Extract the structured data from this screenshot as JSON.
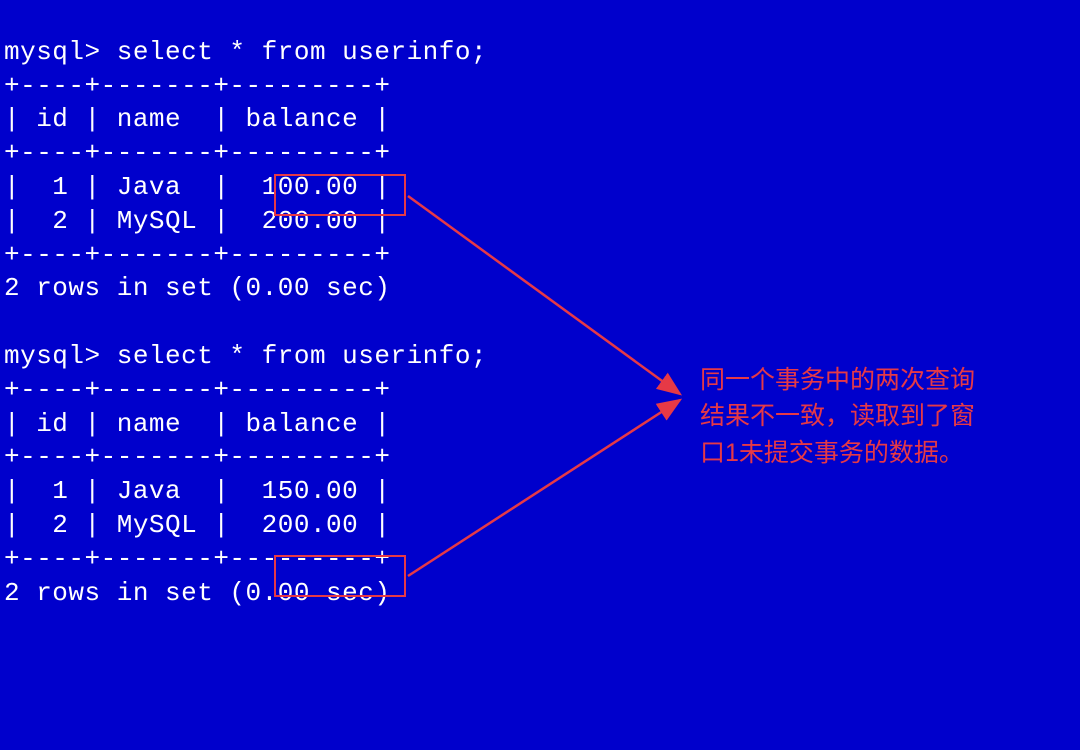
{
  "q1": {
    "prompt_cmd": "mysql> select * from userinfo;",
    "sep": "+----+-------+---------+",
    "hdr": "| id | name  | balance |",
    "r1": "|  1 | Java  |  100.00 |",
    "r2": "|  2 | MySQL |  200.00 |",
    "footer": "2 rows in set (0.00 sec)"
  },
  "q2": {
    "prompt_cmd": "mysql> select * from userinfo;",
    "sep": "+----+-------+---------+",
    "hdr": "| id | name  | balance |",
    "r1": "|  1 | Java  |  150.00 |",
    "r2": "|  2 | MySQL |  200.00 |",
    "footer": "2 rows in set (0.00 sec)"
  },
  "annotation_lines": {
    "l1": "同一个事务中的两次查询",
    "l2": "结果不一致，读取到了窗",
    "l3": "口1未提交事务的数据。"
  }
}
